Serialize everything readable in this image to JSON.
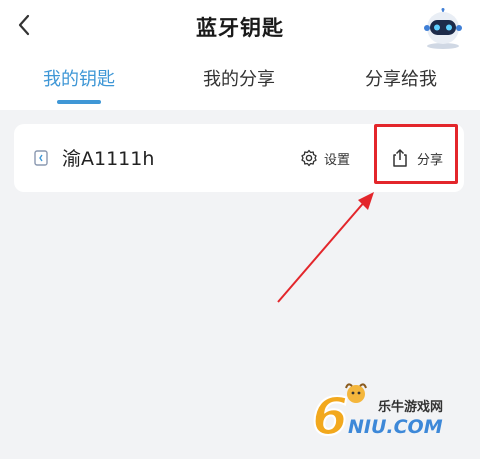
{
  "header": {
    "title": "蓝牙钥匙",
    "back_icon": "chevron-left-icon",
    "avatar_icon": "robot-assistant-icon"
  },
  "tabs": [
    {
      "label": "我的钥匙",
      "active": true
    },
    {
      "label": "我的分享",
      "active": false
    },
    {
      "label": "分享给我",
      "active": false
    }
  ],
  "key_card": {
    "plate": "渝A1111h",
    "key_icon": "bluetooth-key-icon",
    "settings_label": "设置",
    "settings_icon": "gear-icon",
    "share_label": "分享",
    "share_icon": "share-icon"
  },
  "watermark": {
    "cn": "乐牛游戏网",
    "en": "NIU.COM",
    "digit": "6"
  },
  "colors": {
    "accent": "#3f97d6",
    "highlight": "#e3262b",
    "background": "#f2f3f5"
  }
}
